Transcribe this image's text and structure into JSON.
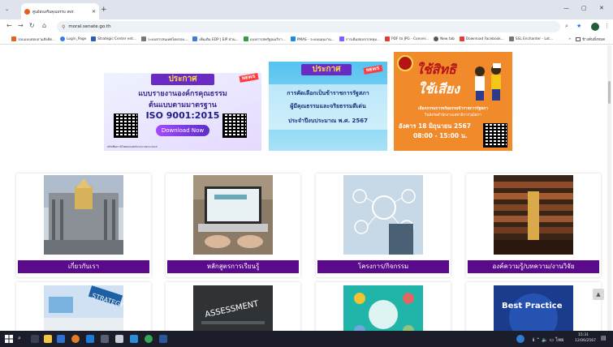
{
  "browser": {
    "tab_title": "ศูนย์ส่งเสริมคุณธรรม สพร.",
    "url": "moral.senate.go.th",
    "window_controls": [
      "—",
      "▢",
      "✕"
    ]
  },
  "bookmarks": {
    "items": [
      {
        "label": "รอบแบบสอบถามสังคีต...",
        "color": "#e5621a"
      },
      {
        "label": "Login_Page",
        "color": "#3c7be0"
      },
      {
        "label": "Strategic Center ent...",
        "color": "#2e5fa8"
      },
      {
        "label": "ระบบสารสนเทศโดยรอบ...",
        "color": "#777777"
      },
      {
        "label": "เพิ่มเติม EDP | EIP ส่วน...",
        "color": "#3c7be0"
      },
      {
        "label": "แบบการสหรัฐอเมริกา...",
        "color": "#2f9e44"
      },
      {
        "label": "PMAS - ระบบแผนงาน...",
        "color": "#1e88e5"
      },
      {
        "label": "การเดิมสอบจากหลุม...",
        "color": "#7b61ff"
      },
      {
        "label": "PDF to JPG - Conver...",
        "color": "#e53935"
      },
      {
        "label": "New tab",
        "color": "#555555"
      },
      {
        "label": "Download Facebook...",
        "color": "#e53935"
      },
      {
        "label": "SSL Enchanter - Lot...",
        "color": "#777777"
      }
    ],
    "all_bookmarks": "ข้างคั่นทั้งหมด"
  },
  "banners": {
    "ita": {
      "heading": "ประกาศ",
      "news": "NEWS",
      "line1": "แบบรายงานองค์กรคุณธรรม",
      "line2": "ต้นแบบตามมาตรฐาน",
      "line3": "ISO 9001:2015",
      "button": "Download Now",
      "footer": "คลิกเพื่อดาวน์โหลดแบบฟอร์ม ISO 9001:2015"
    },
    "award": {
      "heading": "ประกาศ",
      "news": "NEWS",
      "line1": "การคัดเลือกเป็นข้าราชการรัฐสภา",
      "line2": "ผู้มีคุณธรรมและจริยธรรมดีเด่น",
      "line3": "ประจำปีงบประมาณ พ.ศ. 2567"
    },
    "vote": {
      "line1": "ใช้สิทธิ",
      "line2": "ใช้เสียง",
      "desc1": "เลือกกรรมการจริยธรรมข้าราชการรัฐสภา",
      "desc2": "ในสังกัดสำนักงานเลขาธิการวุฒิสภา",
      "date": "อังคาร 18 มิถุนายน 2567",
      "time": "08:00 - 15:00 น."
    }
  },
  "cards_row1": [
    {
      "label": "เกี่ยวกับเรา"
    },
    {
      "label": "หลักสูตรการเรียนรู้"
    },
    {
      "label": "โครงการ/กิจกรรม"
    },
    {
      "label": "องค์ความรู้/บทความ/งานวิจัย"
    }
  ],
  "cards_row2": [
    {
      "caption": "STRATEGY"
    },
    {
      "caption": "ASSESSMENT"
    },
    {
      "caption": ""
    },
    {
      "caption": "Best Practice"
    }
  ],
  "taskbar": {
    "time": "15:31",
    "date": "12/06/2567"
  },
  "colors": {
    "card_label_bg": "#5b0a8c",
    "banner_purple": "#6a2bc4",
    "vote_orange": "#f08a2a"
  }
}
